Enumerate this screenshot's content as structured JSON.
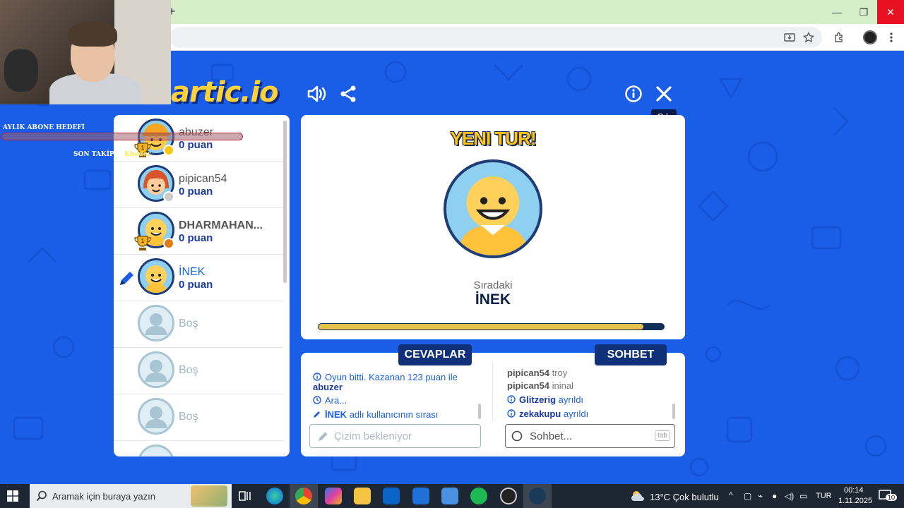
{
  "browser": {
    "new_tab": "+",
    "window_controls": {
      "minimize": "—",
      "restore": "❐",
      "close": "✕"
    }
  },
  "stream_overlay": {
    "goal_label": "AYLIK ABONE HEDEFİ",
    "follower_label": "SON TAKİPÇİ",
    "follower_name": "Khoder"
  },
  "game": {
    "logo": "artic.io",
    "tooltip": "Çık",
    "players": [
      {
        "name": "abuzer",
        "score": "0 puan",
        "trophy": true,
        "dot_color": "#ffc60a",
        "avatar": "cap",
        "style": "normal"
      },
      {
        "name": "pipican54",
        "score": "0 puan",
        "trophy": false,
        "dot_color": "#cccccc",
        "avatar": "girl",
        "style": "normal"
      },
      {
        "name": "DHARMAHAN...",
        "score": "0 puan",
        "trophy": true,
        "dot_color": "#e07a1a",
        "avatar": "bald",
        "style": "bold"
      },
      {
        "name": "İNEK",
        "score": "0 puan",
        "trophy": false,
        "dot_color": "",
        "avatar": "bald",
        "style": "me",
        "drawing": true
      }
    ],
    "empty_slot_label": "Boş",
    "round_title": "YENI TUR!",
    "next_label": "Sıradaki",
    "next_player": "İNEK",
    "progress": 0.94,
    "tabs": {
      "answers": "CEVAPLAR",
      "chat": "SOHBET"
    },
    "answers": [
      {
        "icon": "info",
        "text": "Oyun bitti. Kazanan 123 puan ile",
        "name": "abuzer"
      },
      {
        "icon": "clock",
        "text": "Ara..."
      },
      {
        "icon": "pencil",
        "name": "İNEK",
        "text": "adlı kullanıcının sırası"
      }
    ],
    "answers_placeholder": "Çizim bekleniyor",
    "chat": [
      {
        "name": "pipican54",
        "text": "troy"
      },
      {
        "name": "pipican54",
        "text": "ininal"
      },
      {
        "icon": "info",
        "name": "Glitzerig",
        "text": "ayrıldı"
      },
      {
        "icon": "info",
        "name": "zekakupu",
        "text": "ayrıldı"
      }
    ],
    "chat_placeholder": "Sohbet...",
    "chat_key": "tab"
  },
  "taskbar": {
    "search_placeholder": "Aramak için buraya yazın",
    "weather": "13°C  Çok bulutlu",
    "language": "TUR",
    "time": "00:14",
    "date": "1.11.2025",
    "notifications": "10"
  }
}
